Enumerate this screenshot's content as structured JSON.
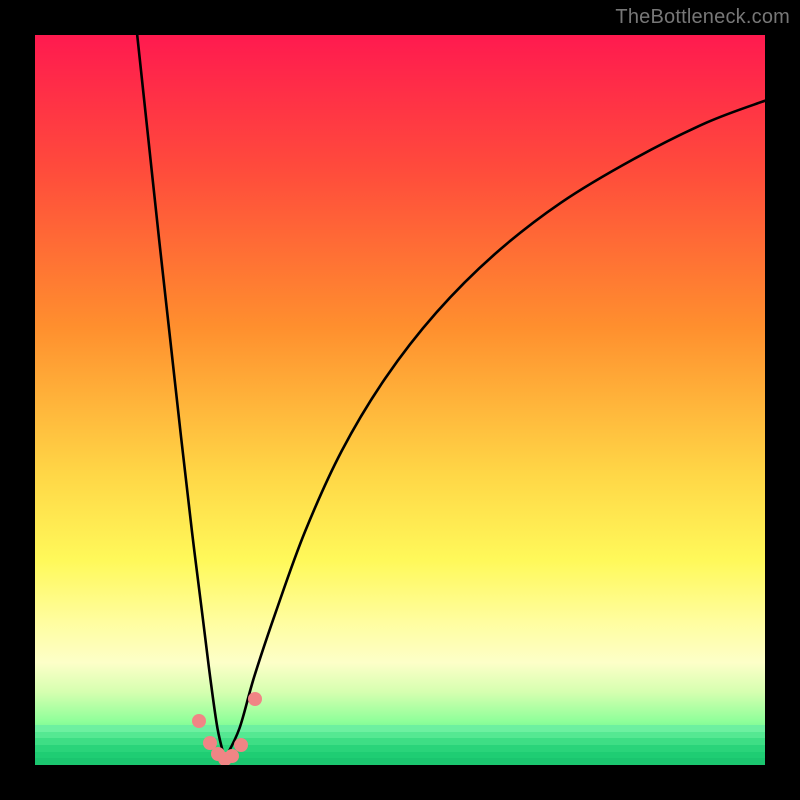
{
  "watermark": "TheBottleneck.com",
  "colors": {
    "frame_bg": "#000000",
    "watermark": "#777777",
    "curve_stroke": "#000000",
    "bead_fill": "#f08585",
    "gradient_stops": [
      {
        "offset": 0.0,
        "color": "#ff1a4f"
      },
      {
        "offset": 0.18,
        "color": "#ff4a3c"
      },
      {
        "offset": 0.4,
        "color": "#ff8f2e"
      },
      {
        "offset": 0.6,
        "color": "#ffd646"
      },
      {
        "offset": 0.72,
        "color": "#fff95a"
      },
      {
        "offset": 0.8,
        "color": "#fffd9c"
      },
      {
        "offset": 0.86,
        "color": "#fdffc8"
      },
      {
        "offset": 0.9,
        "color": "#d6ffb0"
      },
      {
        "offset": 0.94,
        "color": "#8fff9a"
      },
      {
        "offset": 1.0,
        "color": "#22e07a"
      }
    ],
    "bottom_bands": [
      "#6df0a0",
      "#55e892",
      "#3ede85",
      "#2ad47a",
      "#1fcd73",
      "#1bc66f"
    ]
  },
  "chart_data": {
    "type": "line",
    "title": "",
    "xlabel": "",
    "ylabel": "",
    "xlim": [
      0,
      100
    ],
    "ylim": [
      0,
      100
    ],
    "grid": false,
    "legend": false,
    "notes": "V-shaped bottleneck curve with minimum near x≈26. Background is a vertical heat gradient from red (top) through orange/yellow to green (bottom). Pink beads mark the near-zero region of the curve.",
    "series": [
      {
        "name": "left-branch",
        "x": [
          14.0,
          15.5,
          17.0,
          18.5,
          20.0,
          21.5,
          23.0,
          24.0,
          25.0,
          26.0
        ],
        "y": [
          100.0,
          86.0,
          72.0,
          58.5,
          45.0,
          32.0,
          20.0,
          12.0,
          5.0,
          0.8
        ]
      },
      {
        "name": "right-branch",
        "x": [
          26.0,
          28.0,
          30.0,
          33.0,
          37.0,
          42.0,
          48.0,
          55.0,
          63.0,
          72.0,
          82.0,
          92.0,
          100.0
        ],
        "y": [
          0.8,
          5.0,
          12.0,
          21.0,
          32.0,
          43.0,
          53.0,
          62.0,
          70.0,
          77.0,
          83.0,
          88.0,
          91.0
        ]
      }
    ],
    "markers": {
      "name": "beads-near-minimum",
      "x": [
        22.5,
        24.0,
        25.0,
        26.0,
        27.0,
        28.2,
        30.2
      ],
      "y": [
        6.0,
        3.0,
        1.5,
        0.8,
        1.3,
        2.8,
        9.0
      ]
    }
  }
}
